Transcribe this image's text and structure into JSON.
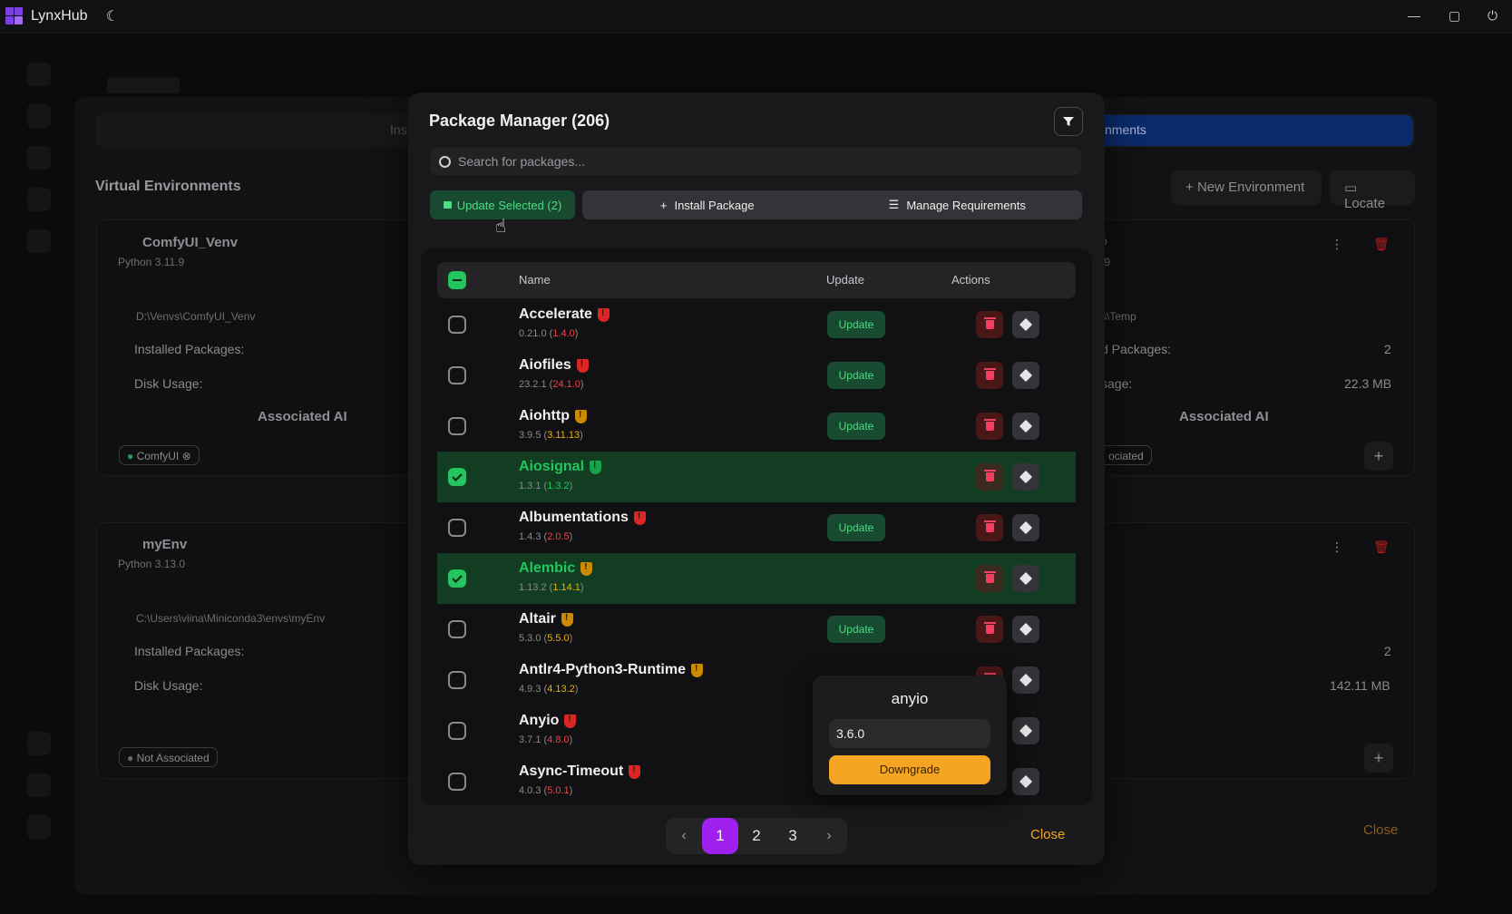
{
  "titlebar": {
    "app_name": "LynxHub",
    "theme_icon": "moon-icon",
    "controls": [
      "minimize-icon",
      "maximize-icon",
      "power-icon"
    ]
  },
  "background": {
    "tab_left_label": "Ins",
    "tab_active_label": "nments",
    "section_title": "Virtual Environments",
    "new_env_label": "New Environment",
    "locate_label": "Locate",
    "cards": [
      {
        "name": "ComfyUI_Venv",
        "python": "Python 3.11.9",
        "path": "D:\\Venvs\\ComfyUI_Venv",
        "installed_label": "Installed Packages:",
        "disk_label": "Disk Usage:",
        "assoc_label": "Associated AI",
        "chip": "ComfyUI"
      },
      {
        "name": "myEnv",
        "python": "Python 3.13.0",
        "path": "C:\\Users\\viina\\Miniconda3\\envs\\myEnv",
        "installed_label": "Installed Packages:",
        "disk_label": "Disk Usage:",
        "chip": "Not Associated"
      }
    ],
    "right_cards": [
      {
        "name_frag": "o",
        "python_frag": ".9",
        "path_frag": "s\\Temp",
        "installed_frag": "d Packages:",
        "installed_value": "2",
        "disk_frag": "sage:",
        "disk_value": "22.3 MB",
        "assoc_label": "Associated AI",
        "chip_frag": "ociated"
      },
      {
        "installed_value": "2",
        "disk_value": "142.11 MB"
      }
    ],
    "close_label": "Close"
  },
  "modal": {
    "title": "Package Manager (206)",
    "search_placeholder": "Search for packages...",
    "update_selected_label": "Update Selected (2)",
    "install_label": "Install Package",
    "requirements_label": "Manage Requirements",
    "headers": {
      "name": "Name",
      "update": "Update",
      "actions": "Actions"
    },
    "update_label": "Update",
    "packages": [
      {
        "name": "Accelerate",
        "current": "0.21.0",
        "latest": "1.4.0",
        "severity": "red",
        "color": "#ef4444",
        "selected": false
      },
      {
        "name": "Aiofiles",
        "current": "23.2.1",
        "latest": "24.1.0",
        "severity": "red",
        "color": "#ef4444",
        "selected": false
      },
      {
        "name": "Aiohttp",
        "current": "3.9.5",
        "latest": "3.11.13",
        "severity": "yellow",
        "color": "#eab308",
        "selected": false
      },
      {
        "name": "Aiosignal",
        "current": "1.3.1",
        "latest": "1.3.2",
        "severity": "green",
        "color": "#22c55e",
        "selected": true
      },
      {
        "name": "Albumentations",
        "current": "1.4.3",
        "latest": "2.0.5",
        "severity": "red",
        "color": "#ef4444",
        "selected": false
      },
      {
        "name": "Alembic",
        "current": "1.13.2",
        "latest": "1.14.1",
        "severity": "yellow",
        "color": "#eab308",
        "selected": true
      },
      {
        "name": "Altair",
        "current": "5.3.0",
        "latest": "5.5.0",
        "severity": "yellow",
        "color": "#eab308",
        "selected": false
      },
      {
        "name": "Antlr4-Python3-Runtime",
        "current": "4.9.3",
        "latest": "4.13.2",
        "severity": "yellow",
        "color": "#eab308",
        "selected": false
      },
      {
        "name": "Anyio",
        "current": "3.7.1",
        "latest": "4.8.0",
        "severity": "red",
        "color": "#ef4444",
        "selected": false
      },
      {
        "name": "Async-Timeout",
        "current": "4.0.3",
        "latest": "5.0.1",
        "severity": "red",
        "color": "#ef4444",
        "selected": false
      }
    ],
    "popover": {
      "title": "anyio",
      "version_value": "3.6.0",
      "action_label": "Downgrade"
    },
    "pagination": {
      "pages": [
        "1",
        "2",
        "3"
      ],
      "current": "1"
    },
    "close_label": "Close"
  }
}
